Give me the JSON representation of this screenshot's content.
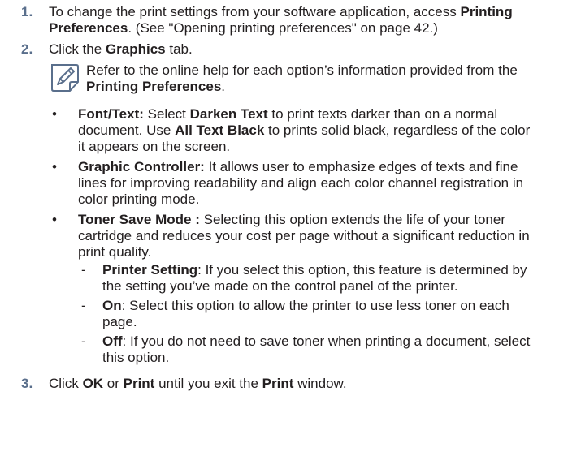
{
  "steps": [
    {
      "num": "1.",
      "parts": [
        {
          "text": "To change the print settings from your software application, access "
        },
        {
          "text": "Printing Preferences",
          "bold": true
        },
        {
          "text": ". (See \"Opening printing preferences\" on page 42.)"
        }
      ]
    },
    {
      "num": "2.",
      "parts": [
        {
          "text": "Click the "
        },
        {
          "text": "Graphics",
          "bold": true
        },
        {
          "text": " tab."
        }
      ]
    },
    {
      "num": "3.",
      "parts": [
        {
          "text": "Click "
        },
        {
          "text": "OK",
          "bold": true
        },
        {
          "text": " or "
        },
        {
          "text": "Print",
          "bold": true
        },
        {
          "text": " until you exit the "
        },
        {
          "text": "Print",
          "bold": true
        },
        {
          "text": " window."
        }
      ]
    }
  ],
  "note": {
    "icon": "note-pencil-icon",
    "parts": [
      {
        "text": "Refer to the online help for each option’s information provided from the "
      },
      {
        "text": "Printing Preferences",
        "bold": true
      },
      {
        "text": "."
      }
    ]
  },
  "bullets": [
    {
      "mark": "•",
      "parts": [
        {
          "text": "Font/Text:",
          "bold": true
        },
        {
          "text": " Select "
        },
        {
          "text": "Darken Text",
          "bold": true
        },
        {
          "text": " to print texts darker than on a normal document. Use "
        },
        {
          "text": "All Text Black",
          "bold": true
        },
        {
          "text": " to prints solid black, regardless of the color it appears on the screen."
        }
      ],
      "subs": []
    },
    {
      "mark": "•",
      "parts": [
        {
          "text": "Graphic Controller:",
          "bold": true
        },
        {
          "text": " It allows user to emphasize edges of texts and fine lines for improving readability and align each color channel registration in color printing mode."
        }
      ],
      "subs": []
    },
    {
      "mark": "•",
      "parts": [
        {
          "text": "Toner Save Mode :",
          "bold": true
        },
        {
          "text": " Selecting this option extends the life of your toner cartridge and reduces your cost per page without a significant reduction in print quality."
        }
      ],
      "subs": [
        {
          "mark": "-",
          "parts": [
            {
              "text": "Printer Setting",
              "bold": true
            },
            {
              "text": ": If you select this option, this feature is determined by the setting you’ve made on the control panel of the printer."
            }
          ]
        },
        {
          "mark": "-",
          "parts": [
            {
              "text": "On",
              "bold": true
            },
            {
              "text": ": Select this option to allow the printer to use less toner on each page."
            }
          ]
        },
        {
          "mark": "-",
          "parts": [
            {
              "text": "Off",
              "bold": true
            },
            {
              "text": ": If you do not need to save toner when printing a document, select this option."
            }
          ]
        }
      ]
    }
  ],
  "colors": {
    "step_number": "#5a6f8c",
    "text": "#231f20",
    "icon": "#5a6f8c"
  }
}
